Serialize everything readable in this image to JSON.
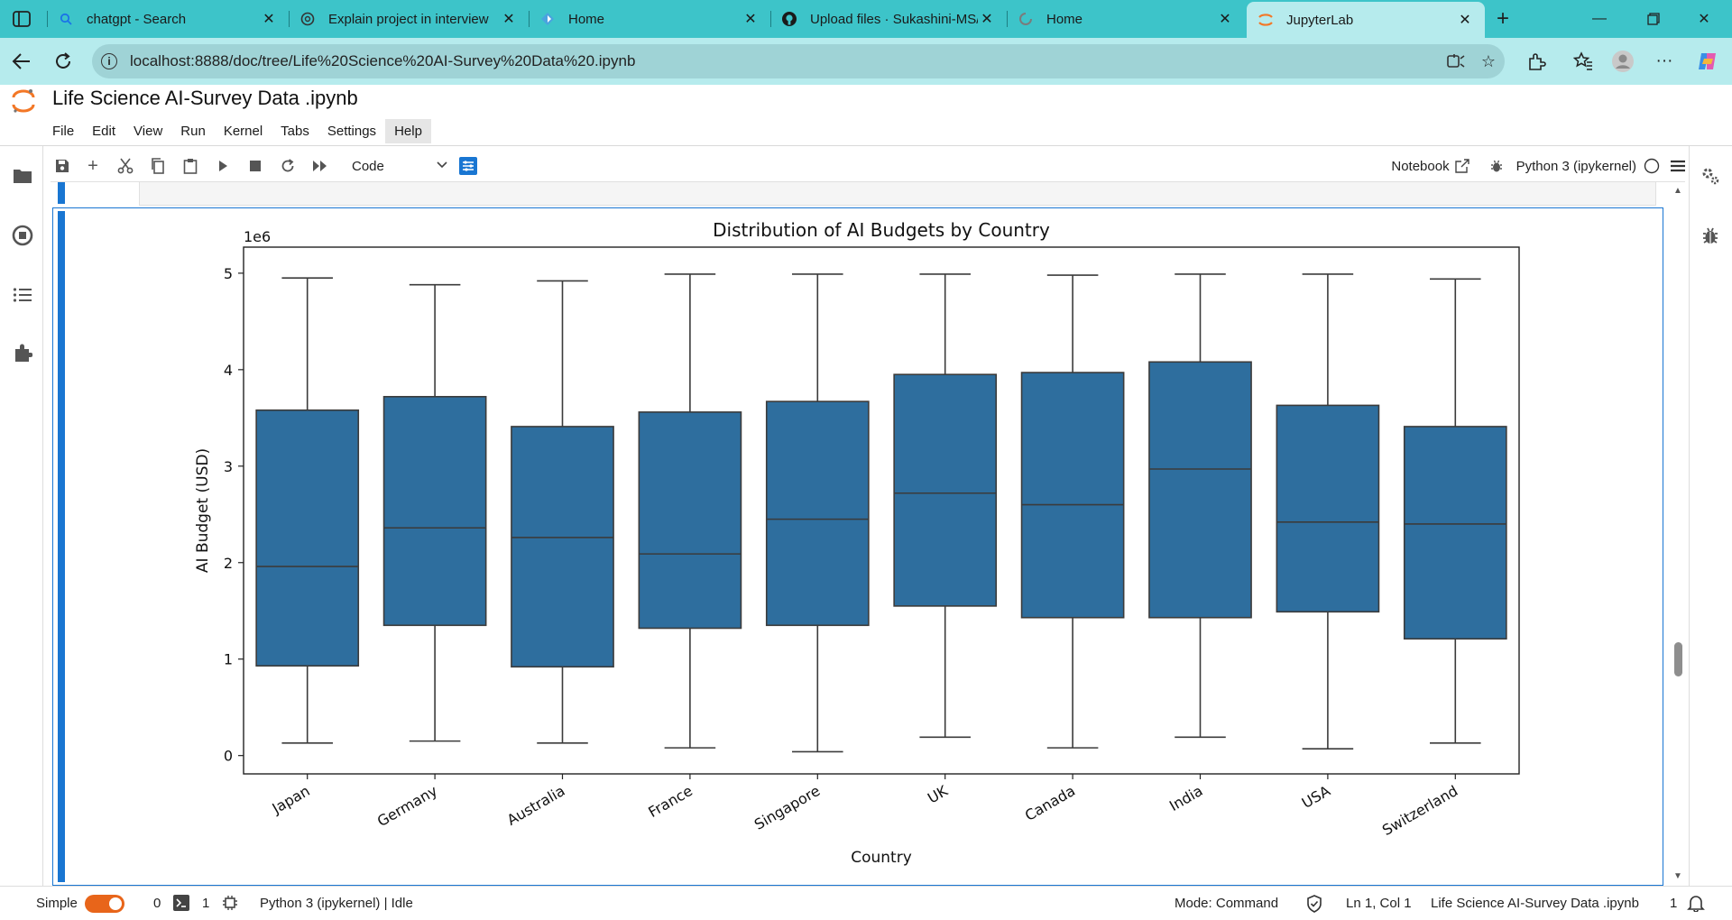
{
  "browser": {
    "tabs": [
      {
        "label": "chatgpt - Search",
        "icon": "search-icon"
      },
      {
        "label": "Explain project in interview",
        "icon": "chatgpt-icon"
      },
      {
        "label": "Home",
        "icon": "home-app-icon"
      },
      {
        "label": "Upload files · Sukashini-MS/",
        "icon": "github-icon"
      },
      {
        "label": "Home",
        "icon": "loading-icon"
      },
      {
        "label": "JupyterLab",
        "icon": "jupyter-icon",
        "active": true
      }
    ],
    "url": "localhost:8888/doc/tree/Life%20Science%20AI-Survey%20Data%20.ipynb",
    "theme_color": "#3dc4c9"
  },
  "jupyter": {
    "document_title": "Life Science AI-Survey Data .ipynb",
    "menu": [
      "File",
      "Edit",
      "View",
      "Run",
      "Kernel",
      "Tabs",
      "Settings",
      "Help"
    ],
    "cell_type": "Code",
    "notebook_label": "Notebook",
    "kernel_name": "Python 3 (ipykernel)",
    "accent_color": "#1976d2"
  },
  "statusbar": {
    "mode_label": "Simple",
    "terminals_count": "0",
    "kernels_count": "1",
    "kernel_status": "Python 3 (ipykernel) | Idle",
    "mode": "Mode: Command",
    "cursor": "Ln 1, Col 1",
    "file_name": "Life Science AI-Survey Data .ipynb",
    "notifications": "1"
  },
  "chart_data": {
    "type": "box",
    "title": "Distribution of AI Budgets by Country",
    "xlabel": "Country",
    "ylabel": "AI Budget (USD)",
    "y_offset_label": "1e6",
    "ylim": [
      -0.19,
      5.27
    ],
    "yticks": [
      "0",
      "1",
      "2",
      "3",
      "4",
      "5"
    ],
    "box_color": "#2e6e9e",
    "categories": [
      "Japan",
      "Germany",
      "Australia",
      "France",
      "Singapore",
      "UK",
      "Canada",
      "India",
      "USA",
      "Switzerland"
    ],
    "boxes": [
      {
        "min": 0.13,
        "q1": 0.93,
        "median": 1.96,
        "q3": 3.58,
        "max": 4.95
      },
      {
        "min": 0.15,
        "q1": 1.35,
        "median": 2.36,
        "q3": 3.72,
        "max": 4.88
      },
      {
        "min": 0.13,
        "q1": 0.92,
        "median": 2.26,
        "q3": 3.41,
        "max": 4.92
      },
      {
        "min": 0.08,
        "q1": 1.32,
        "median": 2.09,
        "q3": 3.56,
        "max": 4.99
      },
      {
        "min": 0.04,
        "q1": 1.35,
        "median": 2.45,
        "q3": 3.67,
        "max": 4.99
      },
      {
        "min": 0.19,
        "q1": 1.55,
        "median": 2.72,
        "q3": 3.95,
        "max": 4.99
      },
      {
        "min": 0.08,
        "q1": 1.43,
        "median": 2.6,
        "q3": 3.97,
        "max": 4.98
      },
      {
        "min": 0.19,
        "q1": 1.43,
        "median": 2.97,
        "q3": 4.08,
        "max": 4.99
      },
      {
        "min": 0.07,
        "q1": 1.49,
        "median": 2.42,
        "q3": 3.63,
        "max": 4.99
      },
      {
        "min": 0.13,
        "q1": 1.21,
        "median": 2.4,
        "q3": 3.41,
        "max": 4.94
      }
    ]
  }
}
